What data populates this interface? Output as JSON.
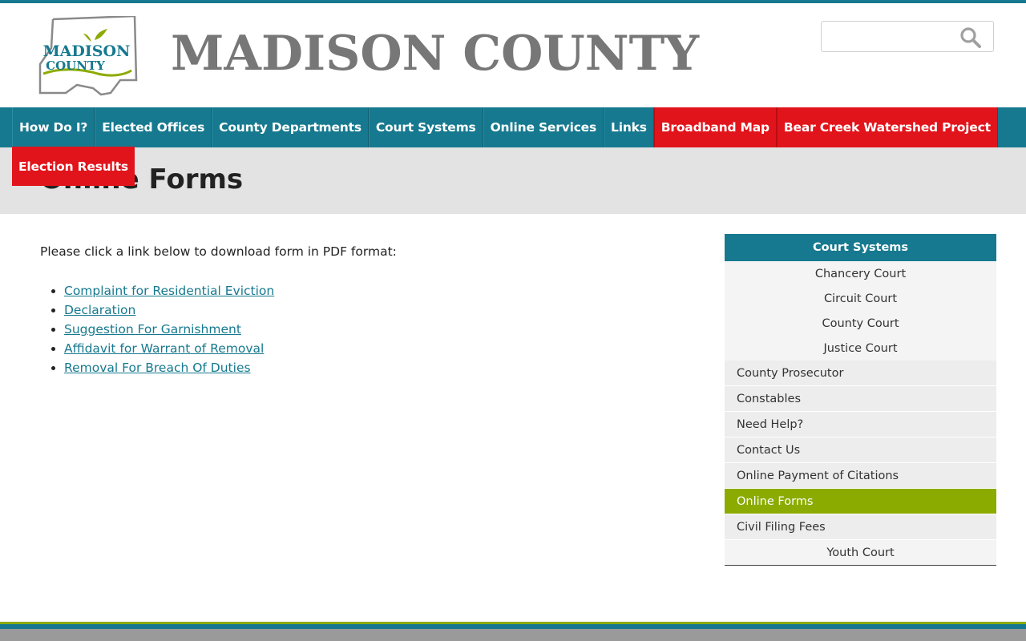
{
  "header": {
    "logo": {
      "line1": "MADISON",
      "line2": "COUNTY"
    },
    "site_title": "MADISON COUNTY",
    "search": {
      "placeholder": "",
      "value": ""
    }
  },
  "nav": {
    "items": [
      {
        "label": "How Do I?",
        "highlight": false
      },
      {
        "label": "Elected Offices",
        "highlight": false
      },
      {
        "label": "County Departments",
        "highlight": false
      },
      {
        "label": "Court Systems",
        "highlight": false
      },
      {
        "label": "Online Services",
        "highlight": false
      },
      {
        "label": "Links",
        "highlight": false
      },
      {
        "label": "Broadband Map",
        "highlight": true
      },
      {
        "label": "Bear Creek Watershed Project",
        "highlight": true
      }
    ],
    "second_row": {
      "label": "Election Results"
    }
  },
  "page": {
    "title": "Online Forms",
    "intro": "Please click a link below to download form in PDF format:",
    "forms": [
      "Complaint for Residential Eviction",
      "Declaration",
      "Suggestion For Garnishment",
      "Affidavit for Warrant of Removal",
      "Removal For Breach Of Duties"
    ]
  },
  "sidebar": {
    "header": "Court Systems",
    "sub_items": [
      "Chancery Court",
      "Circuit Court",
      "County Court",
      "Justice Court"
    ],
    "items": [
      "County Prosecutor",
      "Constables",
      "Need Help?",
      "Contact Us",
      "Online Payment of Citations",
      "Online Forms",
      "Civil Filing Fees",
      "Youth Court"
    ],
    "active": "Online Forms"
  },
  "colors": {
    "brand_teal": "#16798f",
    "alert_red": "#e2141b",
    "accent_green": "#8bab00",
    "title_gray": "#777777"
  },
  "icons": {
    "search": "magnifier-icon",
    "logo": "county-outline-logo"
  }
}
